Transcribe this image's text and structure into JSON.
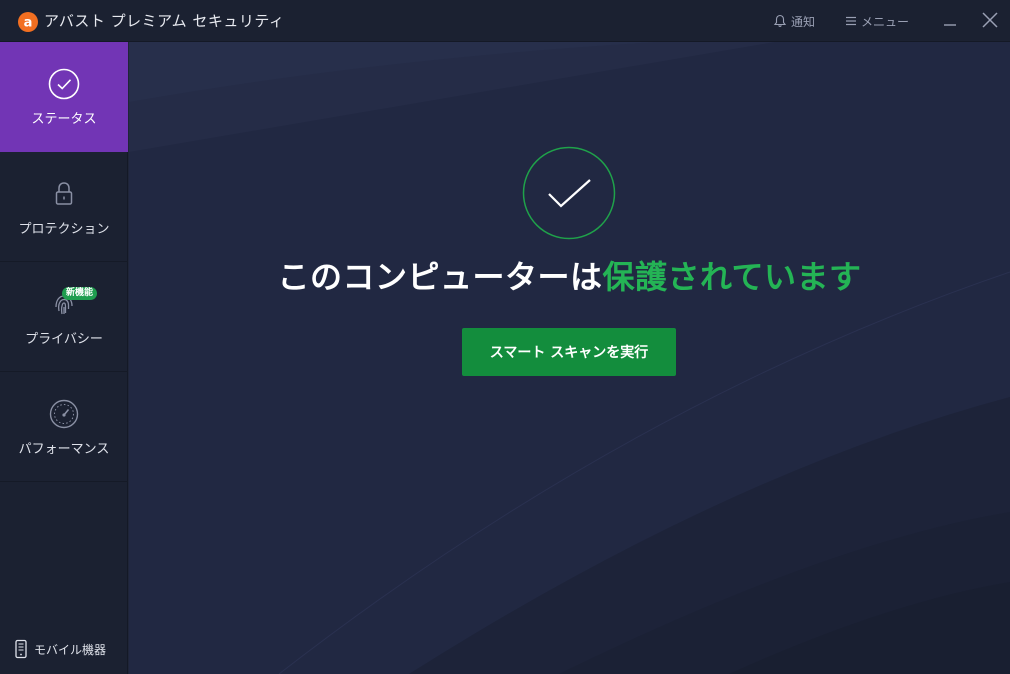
{
  "app": {
    "title": "アバスト プレミアム セキュリティ"
  },
  "titlebar": {
    "notify_label": "通知",
    "menu_label": "メニュー"
  },
  "sidebar": {
    "items": [
      {
        "label": "ステータス",
        "icon": "check-circle-icon",
        "active": true
      },
      {
        "label": "プロテクション",
        "icon": "lock-icon",
        "active": false
      },
      {
        "label": "プライバシー",
        "icon": "fingerprint-icon",
        "active": false,
        "badge": "新機能"
      },
      {
        "label": "パフォーマンス",
        "icon": "speedometer-icon",
        "active": false
      }
    ],
    "mobile_label": "モバイル機器"
  },
  "main": {
    "headline_prefix": "このコンピューターは",
    "headline_status": "保護されています",
    "scan_button_label": "スマート スキャンを実行"
  },
  "colors": {
    "accent_purple": "#7235b5",
    "status_green": "#24b455",
    "button_green": "#138d3d",
    "logo_orange": "#f26f21"
  }
}
